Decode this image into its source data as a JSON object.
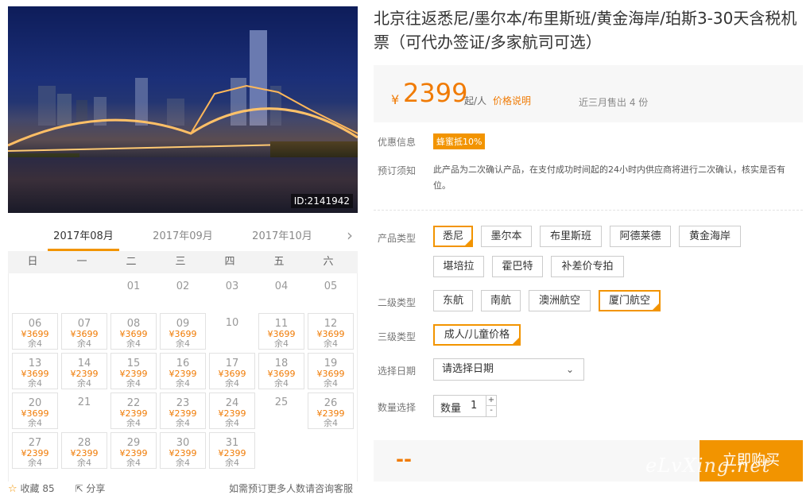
{
  "product": {
    "title": "北京往返悉尼/墨尔本/布里斯班/黄金海岸/珀斯3-30天含税机票（可代办签证/多家航司可选）",
    "photo_id": "ID:2141942"
  },
  "price": {
    "currency": "¥",
    "amount": "2399",
    "per": "起/人",
    "note": "价格说明",
    "sold": "近三月售出 4 份"
  },
  "promo": {
    "label": "优惠信息",
    "badge": "蜂蜜抵10%"
  },
  "booking": {
    "label": "预订须知",
    "text": "此产品为二次确认产品，在支付成功时间起的24小时内供应商将进行二次确认，核实是否有位。"
  },
  "product_type": {
    "label": "产品类型",
    "options": [
      "悉尼",
      "墨尔本",
      "布里斯班",
      "阿德莱德",
      "黄金海岸",
      "堪培拉",
      "霍巴特",
      "补差价专拍"
    ],
    "selected": "悉尼"
  },
  "secondary_type": {
    "label": "二级类型",
    "options": [
      "东航",
      "南航",
      "澳洲航空",
      "厦门航空"
    ],
    "selected": "厦门航空"
  },
  "tertiary_type": {
    "label": "三级类型",
    "options": [
      "成人/儿童价格"
    ],
    "selected": "成人/儿童价格"
  },
  "date": {
    "label": "选择日期",
    "placeholder": "请选择日期"
  },
  "quantity": {
    "label": "数量选择",
    "field_label": "数量",
    "value": "1",
    "plus": "+",
    "minus": "-"
  },
  "buy": {
    "total": "--",
    "button": "立即购买"
  },
  "watermark": "eLvXing.net",
  "calendar": {
    "months": [
      "2017年08月",
      "2017年09月",
      "2017年10月"
    ],
    "active_month": "2017年08月",
    "weekdays": [
      "日",
      "一",
      "二",
      "三",
      "四",
      "五",
      "六"
    ],
    "days": [
      {
        "d": "01"
      },
      {
        "d": "02"
      },
      {
        "d": "03"
      },
      {
        "d": "04"
      },
      {
        "d": "05"
      },
      {
        "d": "06",
        "p": "¥3699",
        "r": "余4"
      },
      {
        "d": "07",
        "p": "¥3699",
        "r": "余4"
      },
      {
        "d": "08",
        "p": "¥3699",
        "r": "余4"
      },
      {
        "d": "09",
        "p": "¥3699",
        "r": "余4"
      },
      {
        "d": "10"
      },
      {
        "d": "11",
        "p": "¥3699",
        "r": "余4"
      },
      {
        "d": "12",
        "p": "¥3699",
        "r": "余4"
      },
      {
        "d": "13",
        "p": "¥3699",
        "r": "余4"
      },
      {
        "d": "14",
        "p": "¥2399",
        "r": "余4"
      },
      {
        "d": "15",
        "p": "¥2399",
        "r": "余4"
      },
      {
        "d": "16",
        "p": "¥2399",
        "r": "余4"
      },
      {
        "d": "17",
        "p": "¥3699",
        "r": "余4"
      },
      {
        "d": "18",
        "p": "¥3699",
        "r": "余4"
      },
      {
        "d": "19",
        "p": "¥3699",
        "r": "余4"
      },
      {
        "d": "20",
        "p": "¥3699",
        "r": "余4"
      },
      {
        "d": "21"
      },
      {
        "d": "22",
        "p": "¥2399",
        "r": "余4"
      },
      {
        "d": "23",
        "p": "¥2399",
        "r": "余4"
      },
      {
        "d": "24",
        "p": "¥2399",
        "r": "余4"
      },
      {
        "d": "25"
      },
      {
        "d": "26",
        "p": "¥2399",
        "r": "余4"
      },
      {
        "d": "27",
        "p": "¥2399",
        "r": "余4"
      },
      {
        "d": "28",
        "p": "¥2399",
        "r": "余4"
      },
      {
        "d": "29",
        "p": "¥2399",
        "r": "余4"
      },
      {
        "d": "30",
        "p": "¥2399",
        "r": "余4"
      },
      {
        "d": "31",
        "p": "¥2399",
        "r": "余4"
      }
    ]
  },
  "footer": {
    "favorite": "收藏",
    "favorite_count": "85",
    "share": "分享",
    "contact_note": "如需预订更多人数请咨询客服"
  },
  "colors": {
    "accent": "#f29400",
    "price": "#f07b05"
  }
}
